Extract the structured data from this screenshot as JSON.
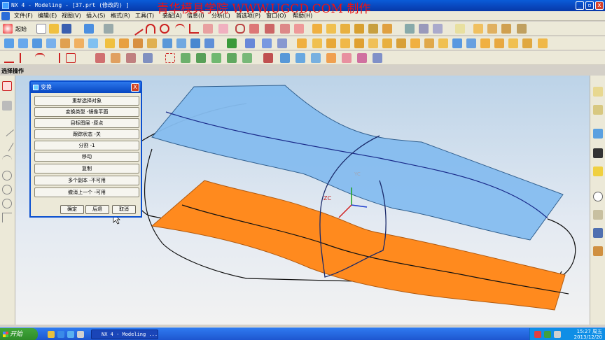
{
  "window": {
    "title": "NX 4 - Modeling - [37.prt (修改的) ]",
    "minimize": "_",
    "restore": "▫",
    "close": "x"
  },
  "watermark": "青华模具学院 WWW.UGCD.COM 制作",
  "menu": [
    "文件(F)",
    "编辑(E)",
    "视图(V)",
    "插入(S)",
    "格式(R)",
    "工具(T)",
    "装配(A)",
    "信息(I)",
    "分析(L)",
    "首选项(P)",
    "窗口(O)",
    "帮助(H)"
  ],
  "toolbar": {
    "start_label": "起始"
  },
  "selection_label": "选择操作",
  "dialog": {
    "title": "变换",
    "close": "X",
    "options": [
      "重新选择对象",
      "变换类型 -镜像平面",
      "目标图层 -原点",
      "跟踪状态 -关",
      "分割 -1",
      "移动",
      "复制",
      "多个副本 -不可用",
      "撤消上一个 -可用"
    ],
    "ok": "确定",
    "back": "后退",
    "cancel": "取消"
  },
  "viewport": {
    "axis_z": "ZC",
    "axis_y": "YC"
  },
  "taskbar": {
    "start": "开始",
    "task": "NX 4 - Modeling ...",
    "time": "15:27 周五",
    "date": "2013/12/20"
  },
  "colors": {
    "surface_blue": "#7fbaf2",
    "surface_orange": "#ff8a1e",
    "titlebar": "#0a4fcf",
    "taskbar": "#2f7af0"
  }
}
